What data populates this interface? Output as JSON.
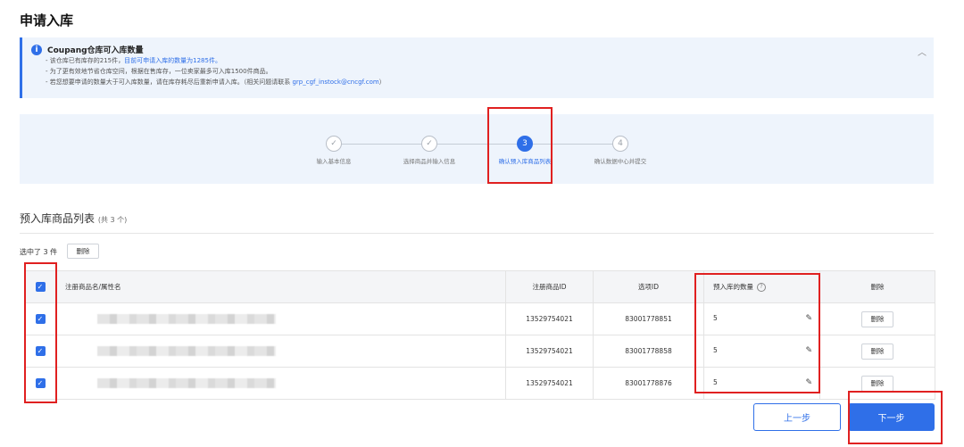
{
  "page": {
    "title": "申请入库"
  },
  "notice": {
    "title": "Coupang仓库可入库数量",
    "lines": [
      {
        "prefix": "- 该仓库已有库存的215件，",
        "highlight": "目前可申请入库的数量为1285件。"
      },
      {
        "prefix": "- 为了更有效地节省仓库空间，根据在售库存，一位卖家最多可入库1500件商品。",
        "highlight": ""
      },
      {
        "prefix": "- 若您想要申请的数量大于可入库数量，请在库存耗尽后重新申请入库。（相关问题请联系 ",
        "highlight": "grp_cgf_instock@cncgf.com",
        "suffix": "）"
      }
    ],
    "collapse_icon": "chevron-up-icon"
  },
  "steps": [
    {
      "marker": "✓",
      "label": "输入基本信息",
      "state": "done"
    },
    {
      "marker": "✓",
      "label": "选择商品并输入信息",
      "state": "done"
    },
    {
      "marker": "3",
      "label": "确认预入库商品列表",
      "state": "active"
    },
    {
      "marker": "4",
      "label": "确认数据中心并提交",
      "state": "todo"
    }
  ],
  "section": {
    "title": "预入库商品列表",
    "count": "(共 3 个)"
  },
  "selection": {
    "text": "选中了 3 件",
    "delete_label": "删除"
  },
  "table": {
    "headers": {
      "checkbox": "✓",
      "name": "注册商品名/属性名",
      "product_id": "注册商品ID",
      "option_id": "选项ID",
      "quantity": "预入库的数量",
      "quantity_help": "?",
      "delete": "删除"
    },
    "rows": [
      {
        "checked": "✓",
        "product_id": "13529754021",
        "option_id": "83001778851",
        "quantity": "5",
        "edit_icon": "pencil-icon",
        "delete_label": "删除"
      },
      {
        "checked": "✓",
        "product_id": "13529754021",
        "option_id": "83001778858",
        "quantity": "5",
        "edit_icon": "pencil-icon",
        "delete_label": "删除"
      },
      {
        "checked": "✓",
        "product_id": "13529754021",
        "option_id": "83001778876",
        "quantity": "5",
        "edit_icon": "pencil-icon",
        "delete_label": "删除"
      }
    ]
  },
  "footer": {
    "prev_label": "上一步",
    "next_label": "下一步"
  },
  "colors": {
    "accent": "#2f6fe8",
    "notice_bg": "#eef4fc",
    "highlight_box": "#e02020"
  }
}
